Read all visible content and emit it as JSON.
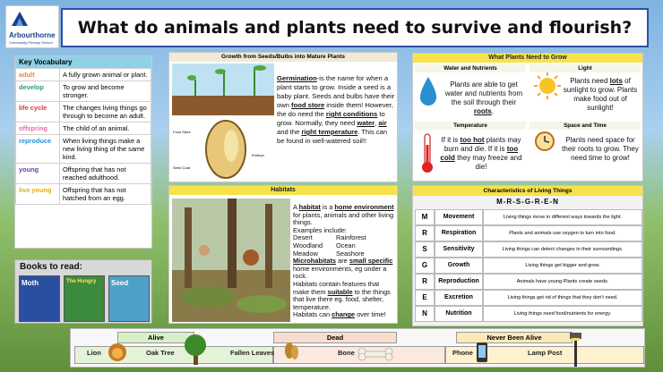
{
  "title": "What do animals and plants need to survive and flourish?",
  "school": {
    "name": "Arbourthorne",
    "subtitle": "Community Primary School"
  },
  "vocab": {
    "heading": "Key Vocabulary",
    "rows": [
      {
        "word": "adult",
        "def": "A fully grown animal or plant.",
        "color": "#e8892a"
      },
      {
        "word": "develop",
        "def": "To grow and become stronger.",
        "color": "#2f9a7c"
      },
      {
        "word": "life cycle",
        "def": "The changes living things go through to become an adult.",
        "color": "#d23a3a"
      },
      {
        "word": "offspring",
        "def": "The child of an animal.",
        "color": "#e66fa7"
      },
      {
        "word": "reproduce",
        "def": "When living things make a new living thing of the same kind.",
        "color": "#2a8fd1"
      },
      {
        "word": "young",
        "def": "Offspring that has not reached adulthood.",
        "color": "#6b3fa0"
      },
      {
        "word": "live young",
        "def": "Offspring that has not hatched from an egg.",
        "color": "#e0b000"
      }
    ]
  },
  "books": {
    "heading": "Books to read:",
    "titles": [
      "Moth",
      "The Hungry",
      "Seed"
    ]
  },
  "growth": {
    "heading": "Growth from Seeds/Bulbs into Mature Plants",
    "labels": [
      "Food Store",
      "Seed Coat",
      "Embryo"
    ],
    "p1": "Germination",
    "p2": "-is the name for when a plant starts to grow. Inside a seed is a baby plant. Seeds and bulbs have their own ",
    "p3": "food store",
    "p4": " inside them! However, the do need the ",
    "p5": "right conditions",
    "p6": " to grow. Normally, they need ",
    "p7": "water",
    "p8": ", ",
    "p9": "air",
    "p10": " and the ",
    "p11": "right temperature",
    "p12": ". This can be found in well-watered soil!!"
  },
  "needs": {
    "heading": "What Plants Need to Grow",
    "cells": [
      {
        "head": "Water and Nutrients",
        "a": "Plants are able to get water and nutrients from the soil through their ",
        "b": "roots",
        "c": "."
      },
      {
        "head": "Light",
        "a": "Plants need ",
        "b": "lots",
        "c": " of sunlight to grow. Plants make food out of sunlight!"
      },
      {
        "head": "Temperature",
        "a": "If it is ",
        "b": "too hot",
        "c": " plants may burn and die. If it is ",
        "d": "too cold",
        "e": " they may freeze and die!"
      },
      {
        "head": "Space and Time",
        "a": "Plants need space for their roots to grow. They need time to grow!"
      }
    ]
  },
  "habitats": {
    "heading": "Habitats",
    "intro_a": "A ",
    "intro_b": "habitat",
    "intro_c": " is a ",
    "intro_d": "home environment",
    "intro_e": " for plants, animals and other living things.",
    "examples_label": "Examples include:",
    "examples": [
      "Desert",
      "Rainforest",
      "Woodland",
      "Ocean",
      "Meadow",
      "Seashore"
    ],
    "micro_a": "Microhabitats",
    "micro_b": " are ",
    "micro_c": "small specific",
    "micro_d": " home environments, eg under a rock.",
    "feat_a": "Habitats contain features that make them ",
    "feat_b": "suitable",
    "feat_c": " to the things that live there eg. food, shelter, temperature.",
    "change_a": "Habitats can ",
    "change_b": "change",
    "change_c": " over time!"
  },
  "mrs": {
    "heading": "Characteristics of Living Things",
    "acronym": "M-R-S-G-R-E-N",
    "rows": [
      {
        "letter": "M",
        "name": "Movement",
        "desc": "Living things move in different ways towards the light."
      },
      {
        "letter": "R",
        "name": "Respiration",
        "desc": "Plants and animals use oxygen to turn into food."
      },
      {
        "letter": "S",
        "name": "Sensitivity",
        "desc": "Living things can detect changes in their surroundings."
      },
      {
        "letter": "G",
        "name": "Growth",
        "desc": "Living things get bigger and grow."
      },
      {
        "letter": "R",
        "name": "Reproduction",
        "desc": "Animals have young Plants create seeds."
      },
      {
        "letter": "E",
        "name": "Excretion",
        "desc": "Living things get rid of things that they don't need."
      },
      {
        "letter": "N",
        "name": "Nutrition",
        "desc": "Living things need food/nutrients for energy."
      }
    ]
  },
  "classify": {
    "categories": [
      "Alive",
      "Dead",
      "Never Been Alive"
    ],
    "items": [
      "Lion",
      "Oak Tree",
      "Fallen Leaves",
      "Bone",
      "Phone",
      "Lamp Post"
    ]
  }
}
